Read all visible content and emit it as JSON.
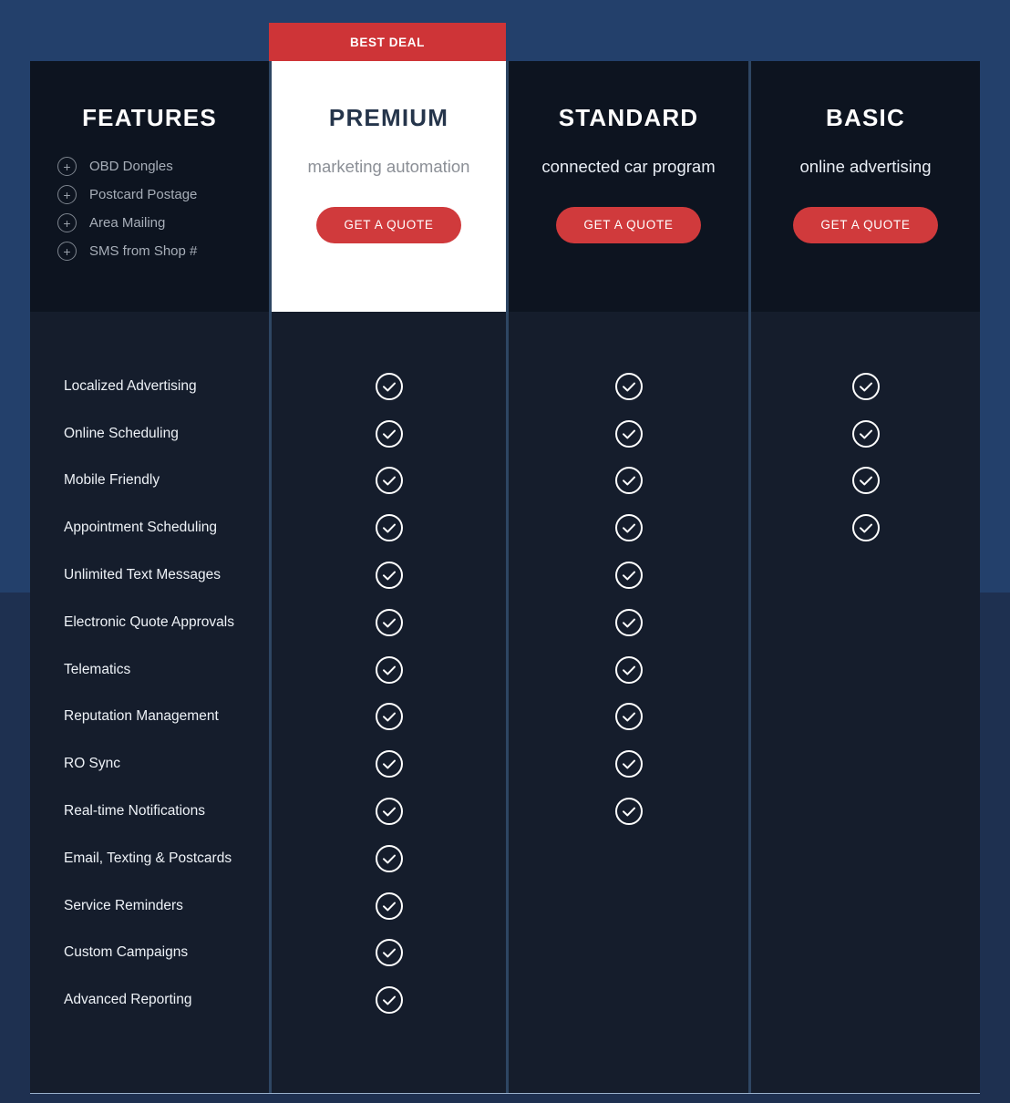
{
  "banner": {
    "best_deal_label": "BEST DEAL"
  },
  "colors": {
    "page_background": "#23406b",
    "page_background_lower": "#1e3050",
    "banner_red": "#ce3437",
    "button_red": "#d03a3c",
    "column_dark": "#0d1420",
    "rows_dark": "#151d2c",
    "premium_white": "#ffffff",
    "separator": "#2e4663"
  },
  "columns": {
    "features": {
      "title": "FEATURES",
      "extras": [
        {
          "icon": "plus-icon",
          "label": "OBD Dongles"
        },
        {
          "icon": "plus-icon",
          "label": "Postcard Postage"
        },
        {
          "icon": "plus-icon",
          "label": "Area Mailing"
        },
        {
          "icon": "plus-icon",
          "label": "SMS from Shop #"
        }
      ]
    },
    "premium": {
      "title": "PREMIUM",
      "subtitle": "marketing automation",
      "cta_label": "GET A QUOTE",
      "highlighted": true
    },
    "standard": {
      "title": "STANDARD",
      "subtitle": "connected car program",
      "cta_label": "GET A QUOTE",
      "highlighted": false
    },
    "basic": {
      "title": "BASIC",
      "subtitle": "online advertising",
      "cta_label": "GET A QUOTE",
      "highlighted": false
    }
  },
  "feature_rows": [
    {
      "label": "Localized Advertising",
      "premium": true,
      "standard": true,
      "basic": true
    },
    {
      "label": "Online Scheduling",
      "premium": true,
      "standard": true,
      "basic": true
    },
    {
      "label": "Mobile Friendly",
      "premium": true,
      "standard": true,
      "basic": true
    },
    {
      "label": "Appointment Scheduling",
      "premium": true,
      "standard": true,
      "basic": true
    },
    {
      "label": "Unlimited Text Messages",
      "premium": true,
      "standard": true,
      "basic": false
    },
    {
      "label": "Electronic Quote Approvals",
      "premium": true,
      "standard": true,
      "basic": false
    },
    {
      "label": "Telematics",
      "premium": true,
      "standard": true,
      "basic": false
    },
    {
      "label": "Reputation Management",
      "premium": true,
      "standard": true,
      "basic": false
    },
    {
      "label": "RO Sync",
      "premium": true,
      "standard": true,
      "basic": false
    },
    {
      "label": "Real-time Notifications",
      "premium": true,
      "standard": true,
      "basic": false
    },
    {
      "label": "Email, Texting & Postcards",
      "premium": true,
      "standard": false,
      "basic": false
    },
    {
      "label": "Service Reminders",
      "premium": true,
      "standard": false,
      "basic": false
    },
    {
      "label": "Custom Campaigns",
      "premium": true,
      "standard": false,
      "basic": false
    },
    {
      "label": "Advanced Reporting",
      "premium": true,
      "standard": false,
      "basic": false
    }
  ],
  "icons": {
    "check": "check-circle-icon",
    "plus": "plus-circle-icon"
  }
}
